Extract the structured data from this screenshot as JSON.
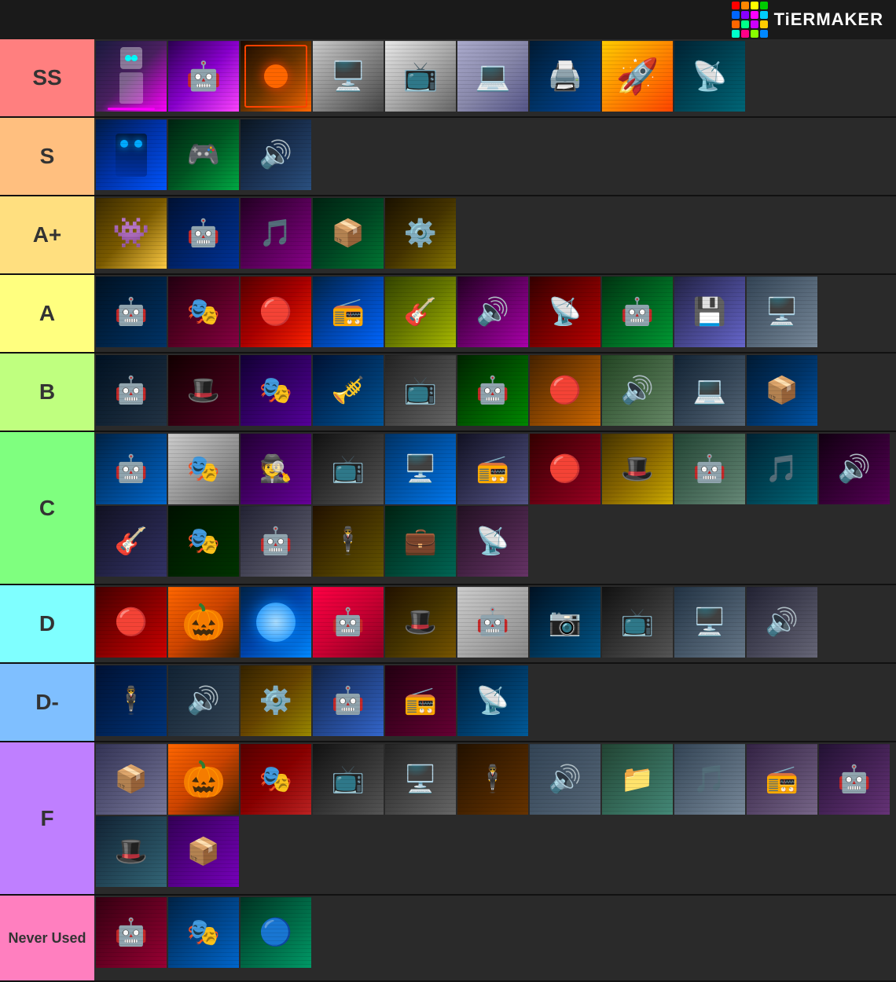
{
  "header": {
    "logo_text": "TiERMAKER"
  },
  "logo_colors": [
    "#ff0000",
    "#ff8800",
    "#ffff00",
    "#00cc00",
    "#0066ff",
    "#8800ff",
    "#ff00ff",
    "#00ccff",
    "#ff6600",
    "#00ff88",
    "#cc00ff",
    "#ffcc00",
    "#00ffcc",
    "#ff0088",
    "#88ff00",
    "#0088ff"
  ],
  "tiers": [
    {
      "id": "ss",
      "label": "SS",
      "color": "#ff7f7f",
      "item_count": 9
    },
    {
      "id": "s",
      "label": "S",
      "color": "#ffbf7f",
      "item_count": 3
    },
    {
      "id": "aplus",
      "label": "A+",
      "color": "#ffdf7f",
      "item_count": 5
    },
    {
      "id": "a",
      "label": "A",
      "color": "#ffff7f",
      "item_count": 10
    },
    {
      "id": "b",
      "label": "B",
      "color": "#bfff7f",
      "item_count": 10
    },
    {
      "id": "c",
      "label": "C",
      "color": "#7fff7f",
      "item_count": 17
    },
    {
      "id": "d",
      "label": "D",
      "color": "#7fffff",
      "item_count": 10
    },
    {
      "id": "dminus",
      "label": "D-",
      "color": "#7fbfff",
      "item_count": 6
    },
    {
      "id": "f",
      "label": "F",
      "color": "#bf7fff",
      "item_count": 13
    },
    {
      "id": "never",
      "label": "Never Used",
      "color": "#ff7fbf",
      "item_count": 3
    }
  ]
}
